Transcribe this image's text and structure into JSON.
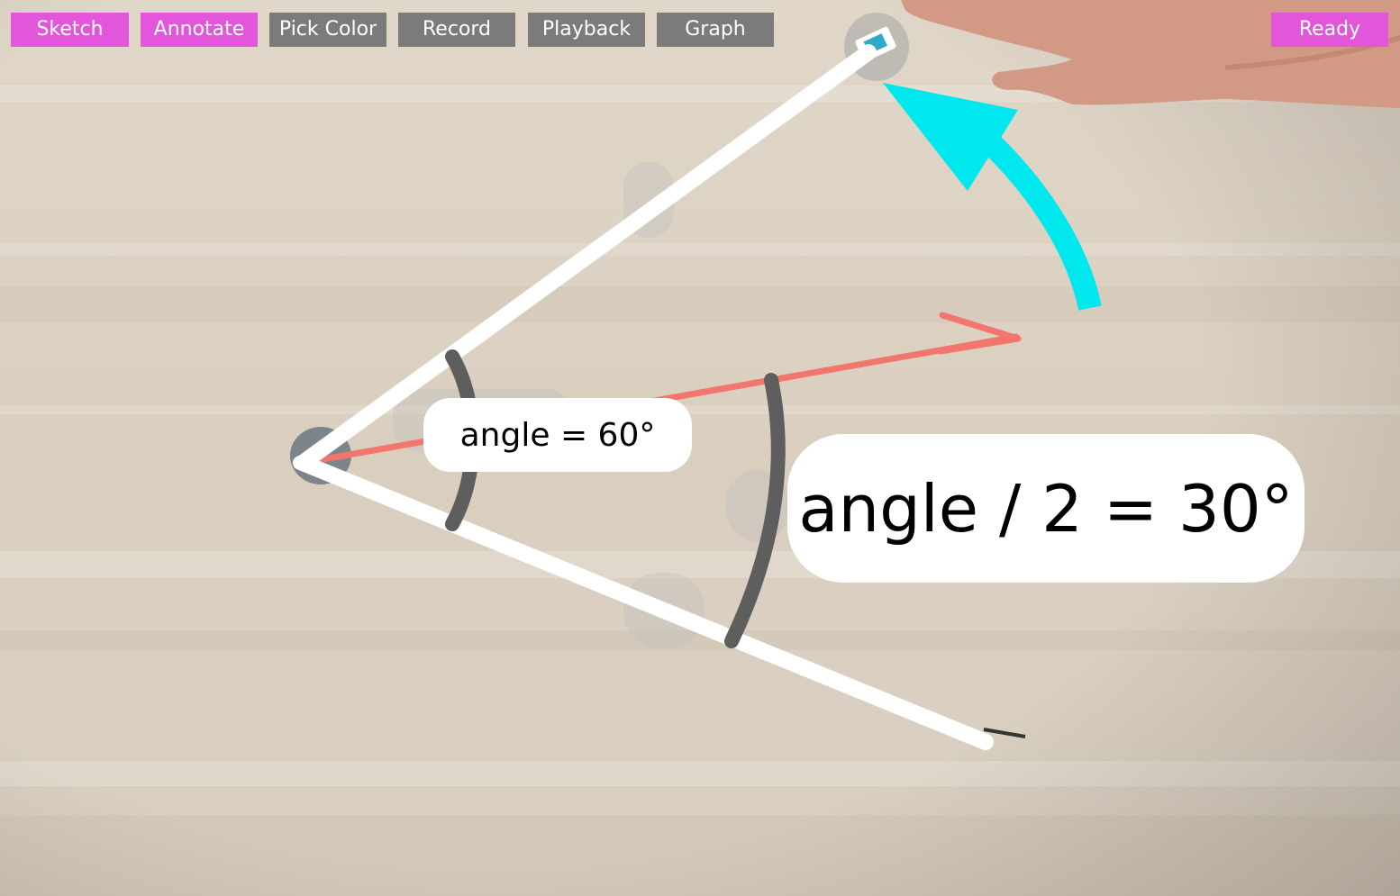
{
  "toolbar": {
    "buttons": [
      {
        "label": "Sketch",
        "style": "pink"
      },
      {
        "label": "Annotate",
        "style": "pink"
      },
      {
        "label": "Pick Color",
        "style": "gray"
      },
      {
        "label": "Record",
        "style": "gray"
      },
      {
        "label": "Playback",
        "style": "gray"
      },
      {
        "label": "Graph",
        "style": "gray"
      }
    ],
    "status_label": "Ready"
  },
  "annotations": {
    "angle_label": "angle = 60°",
    "half_angle_label": "angle / 2 = 30°"
  },
  "colors": {
    "accent_pink": "#e356dc",
    "button_gray": "#7b7b7b",
    "arm_line": "#ffffff",
    "bisector_line": "#f3766e",
    "rotation_arrow": "#00e8ee",
    "arc_marker": "#5e5e5e",
    "wood_background": "#dcd2c3"
  }
}
